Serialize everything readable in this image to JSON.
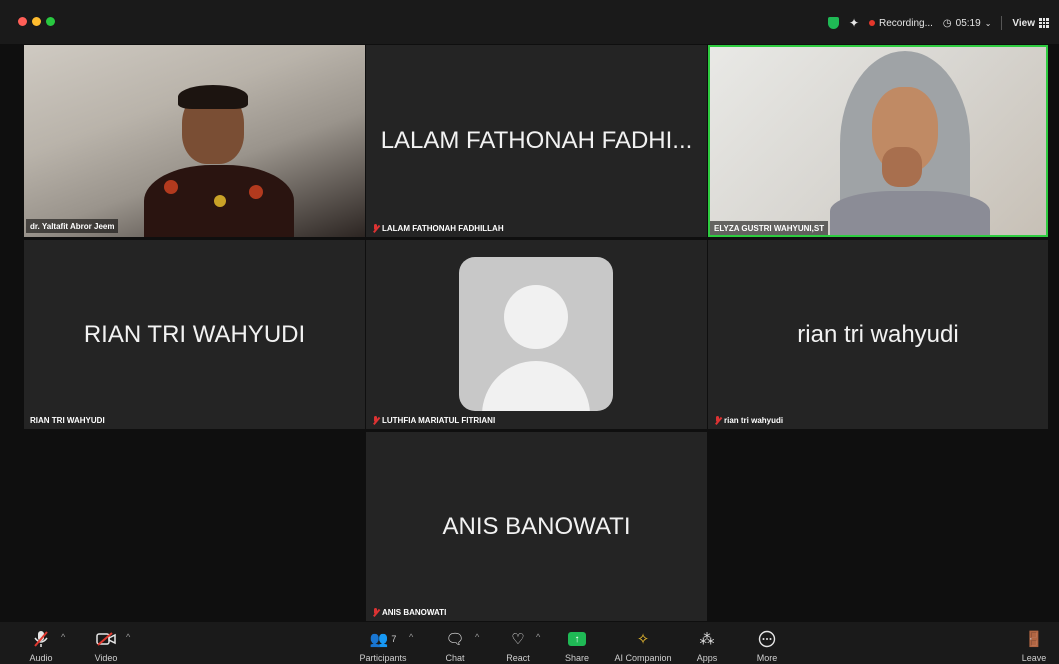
{
  "topbar": {
    "recording": "Recording...",
    "timer": "05:19",
    "view": "View"
  },
  "tiles": [
    {
      "name": "dr. Yaltafit Abror Jeem"
    },
    {
      "display": "LALAM FATHONAH FADHI...",
      "name": "LALAM FATHONAH FADHILLAH"
    },
    {
      "name": "ELYZA GUSTRI WAHYUNI,ST"
    },
    {
      "display": "RIAN TRI WAHYUDI",
      "name": "RIAN TRI WAHYUDI"
    },
    {
      "name": "LUTHFIA MARIATUL FITRIANI"
    },
    {
      "display": "rian tri wahyudi",
      "name": "rian tri wahyudi"
    },
    {
      "display": "ANIS BANOWATI",
      "name": "ANIS BANOWATI"
    }
  ],
  "toolbar": {
    "audio": "Audio",
    "video": "Video",
    "participants": "Participants",
    "participants_count": "7",
    "chat": "Chat",
    "react": "React",
    "share": "Share",
    "ai_companion": "AI Companion",
    "apps": "Apps",
    "more": "More",
    "leave": "Leave"
  }
}
